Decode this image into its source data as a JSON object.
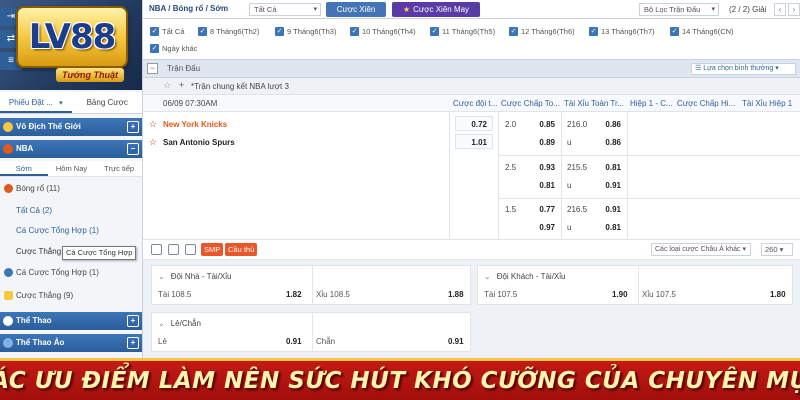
{
  "sidebar": {
    "logo_text": "LV88",
    "logo_sub": "Tướng Thuật",
    "tabs": [
      "Phiếu Đặt ...",
      "Bảng Cược"
    ],
    "sections": {
      "champion": "Vô Địch Thế Giới",
      "nba": "NBA",
      "sport": "Thể Thao",
      "virtual": "Thể Thao Ảo"
    },
    "sub_tabs": [
      "Sớm",
      "Hôm Nay",
      "Trực tiếp"
    ],
    "basketball": "Bóng rổ",
    "basketball_count": "(11)",
    "items": [
      {
        "label": "Tất Cả",
        "count": "(2)"
      },
      {
        "label": "Cá Cược Tổng Hợp",
        "count": "(1)"
      },
      {
        "label": "Cược Thắng",
        "count": ""
      }
    ],
    "tooltip": "Cá Cược Tổng Hợp",
    "more_items": [
      {
        "label": "Cá Cược Tổng Hợp",
        "count": "(1)"
      },
      {
        "label": "Cược Thắng",
        "count": "(9)"
      }
    ]
  },
  "topbar": {
    "breadcrumb": "NBA / Bóng rổ / Sớm",
    "sport_select": "Tất Cả",
    "btn_cuoc_xien": "Cược Xiên",
    "btn_may_man": "Cược Xiên May Mắn",
    "filter_select": "Bộ Lọc Trận Đấu",
    "page_info": "(2 / 2) Giải",
    "prev": "‹",
    "next": "›"
  },
  "date_filters": [
    "Tất Cả",
    "8 Tháng6(Th2)",
    "9 Tháng6(Th3)",
    "10 Tháng6(Th4)",
    "11 Tháng6(Th5)",
    "12 Tháng6(Th6)",
    "13 Tháng6(Th7)",
    "14 Tháng6(CN)",
    "Ngày khác"
  ],
  "table": {
    "title": "Trận Đấu",
    "sort": "Lựa chọn bình thường",
    "league": "*Trận chung kết NBA lượt 3",
    "time": "06/09 07:30AM",
    "columns": [
      "Cược đội t...",
      "Cược Chấp To...",
      "Tài Xỉu Toàn Tr...",
      "Hiệp 1 - C...",
      "Cược Chấp Hi...",
      "Tài Xỉu Hiệp 1"
    ],
    "home": "New York Knicks",
    "away": "San Antonio Spurs",
    "moneyline": [
      "0.72",
      "1.01"
    ],
    "lines": [
      {
        "hc": "2.0",
        "hc_home": "0.85",
        "hc_away": "0.89",
        "ou": "216.0",
        "ou_over": "0.86",
        "u": "u",
        "ou_under": "0.86"
      },
      {
        "hc": "2.5",
        "hc_home": "0.93",
        "hc_away": "0.81",
        "ou": "215.5",
        "ou_over": "0.81",
        "u": "u",
        "ou_under": "0.91"
      },
      {
        "hc": "1.5",
        "hc_home": "0.77",
        "hc_away": "0.97",
        "ou": "216.5",
        "ou_over": "0.91",
        "u": "u",
        "ou_under": "0.81"
      }
    ]
  },
  "toolbar": {
    "smp": "SMP",
    "cau_thu": "Cầu thủ",
    "type_select": "Các loại cược Châu Á khác",
    "count_select": "260"
  },
  "markets": {
    "home_ou": {
      "title": "Đội Nhà - Tài/Xỉu",
      "tai_label": "Tài",
      "tai_line": "108.5",
      "tai_odd": "1.82",
      "xiu_label": "Xỉu",
      "xiu_line": "108.5",
      "xiu_odd": "1.88"
    },
    "away_ou": {
      "title": "Đội Khách - Tài/Xỉu",
      "tai_label": "Tài",
      "tai_line": "107.5",
      "tai_odd": "1.90",
      "xiu_label": "Xỉu",
      "xiu_line": "107.5",
      "xiu_odd": "1.80"
    },
    "odd_even": {
      "title": "Lẻ/Chẵn",
      "le_label": "Lẻ",
      "le_odd": "0.91",
      "chan_label": "Chẵn",
      "chan_odd": "0.91"
    }
  },
  "banner": {
    "title": "CÁC ƯU ĐIỂM LÀM NÊN SỨC HÚT KHÓ CƯỠNG CỦA CHUYÊN MỤC"
  },
  "colors": {
    "accent": "#2f5f98",
    "home_team": "#e05a1a",
    "banner_red": "#c41a14",
    "banner_text": "#fff3b0",
    "gold": "#f2c54a"
  }
}
